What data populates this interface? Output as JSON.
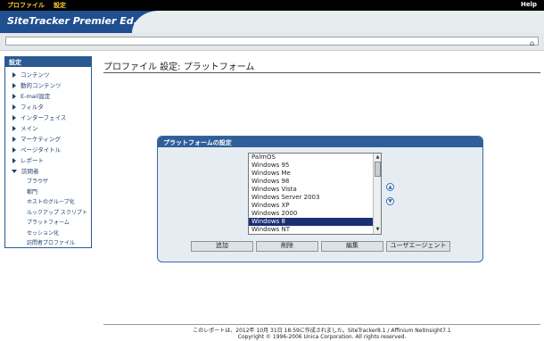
{
  "topbar": {
    "menu1": "プロファイル",
    "menu2": "設定",
    "help": "Help"
  },
  "brand": {
    "logo": "SiteTracker Premier Ed."
  },
  "sidebar": {
    "header": "設定",
    "items": [
      {
        "label": "コンテンツ"
      },
      {
        "label": "動的コンテンツ"
      },
      {
        "label": "E-mail設定"
      },
      {
        "label": "フィルタ"
      },
      {
        "label": "インターフェイス"
      },
      {
        "label": "メイン"
      },
      {
        "label": "マーケティング"
      },
      {
        "label": "ページタイトル"
      },
      {
        "label": "レポート"
      },
      {
        "label": "訪問者"
      }
    ],
    "subitems": [
      {
        "label": "ブラウザ"
      },
      {
        "label": "都門"
      },
      {
        "label": "ホストのグループ化"
      },
      {
        "label": "ルックアップ スクリプト"
      },
      {
        "label": "プラットフォーム"
      },
      {
        "label": "セッション化"
      },
      {
        "label": "訪問者プロファイル"
      }
    ]
  },
  "page": {
    "title_main": "プロファイル 設定: ",
    "title_sub": "プラットフォーム"
  },
  "panel": {
    "title": "プラットフォームの設定",
    "options": [
      "PalmOS",
      "Windows 95",
      "Windows Me",
      "Windows 98",
      "Windows Vista",
      "Windows Server 2003",
      "Windows XP",
      "Windows 2000",
      "Windows 8",
      "Windows NT"
    ],
    "selected": "Windows 8",
    "buttons": {
      "add": "追加",
      "delete": "削除",
      "edit": "編集",
      "user_agent": "ユーザエージェント"
    }
  },
  "footer": {
    "line1": "このレポートは、2012年 10月 31日 18:59に作成されました。SiteTracker8.1 / Affinium NetInsight7.1",
    "line2": "Copyright © 1996-2006 Unica Corporation. All rights reserved."
  },
  "colors": {
    "brand": "#1f4f8f",
    "accent_text": "#ffcc33",
    "selection": "#1c2f75"
  }
}
